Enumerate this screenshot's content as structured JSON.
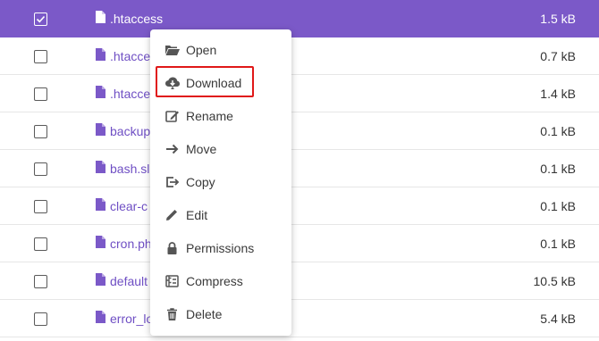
{
  "files": [
    {
      "name": ".htaccess",
      "size": "1.5 kB",
      "selected": true
    },
    {
      "name": ".htacce",
      "size": "0.7 kB",
      "selected": false
    },
    {
      "name": ".htacce",
      "size": "1.4 kB",
      "selected": false
    },
    {
      "name": "backup",
      "size": "0.1 kB",
      "selected": false
    },
    {
      "name": "bash.sl",
      "size": "0.1 kB",
      "selected": false
    },
    {
      "name": "clear-c",
      "size": "0.1 kB",
      "selected": false
    },
    {
      "name": "cron.ph",
      "size": "0.1 kB",
      "selected": false
    },
    {
      "name": "default",
      "size": "10.5 kB",
      "selected": false
    },
    {
      "name": "error_lo",
      "size": "5.4 kB",
      "selected": false
    }
  ],
  "context_menu": {
    "items": [
      {
        "label": "Open",
        "icon": "folder-open-icon"
      },
      {
        "label": "Download",
        "icon": "cloud-download-icon"
      },
      {
        "label": "Rename",
        "icon": "rename-icon"
      },
      {
        "label": "Move",
        "icon": "arrow-right-icon"
      },
      {
        "label": "Copy",
        "icon": "copy-icon"
      },
      {
        "label": "Edit",
        "icon": "pencil-icon"
      },
      {
        "label": "Permissions",
        "icon": "lock-icon"
      },
      {
        "label": "Compress",
        "icon": "compress-icon"
      },
      {
        "label": "Delete",
        "icon": "trash-icon"
      }
    ],
    "highlighted_item": "Download"
  },
  "colors": {
    "selected_row": "#7b59c8",
    "file_name": "#6f4fc4",
    "highlight_border": "#e01818"
  }
}
